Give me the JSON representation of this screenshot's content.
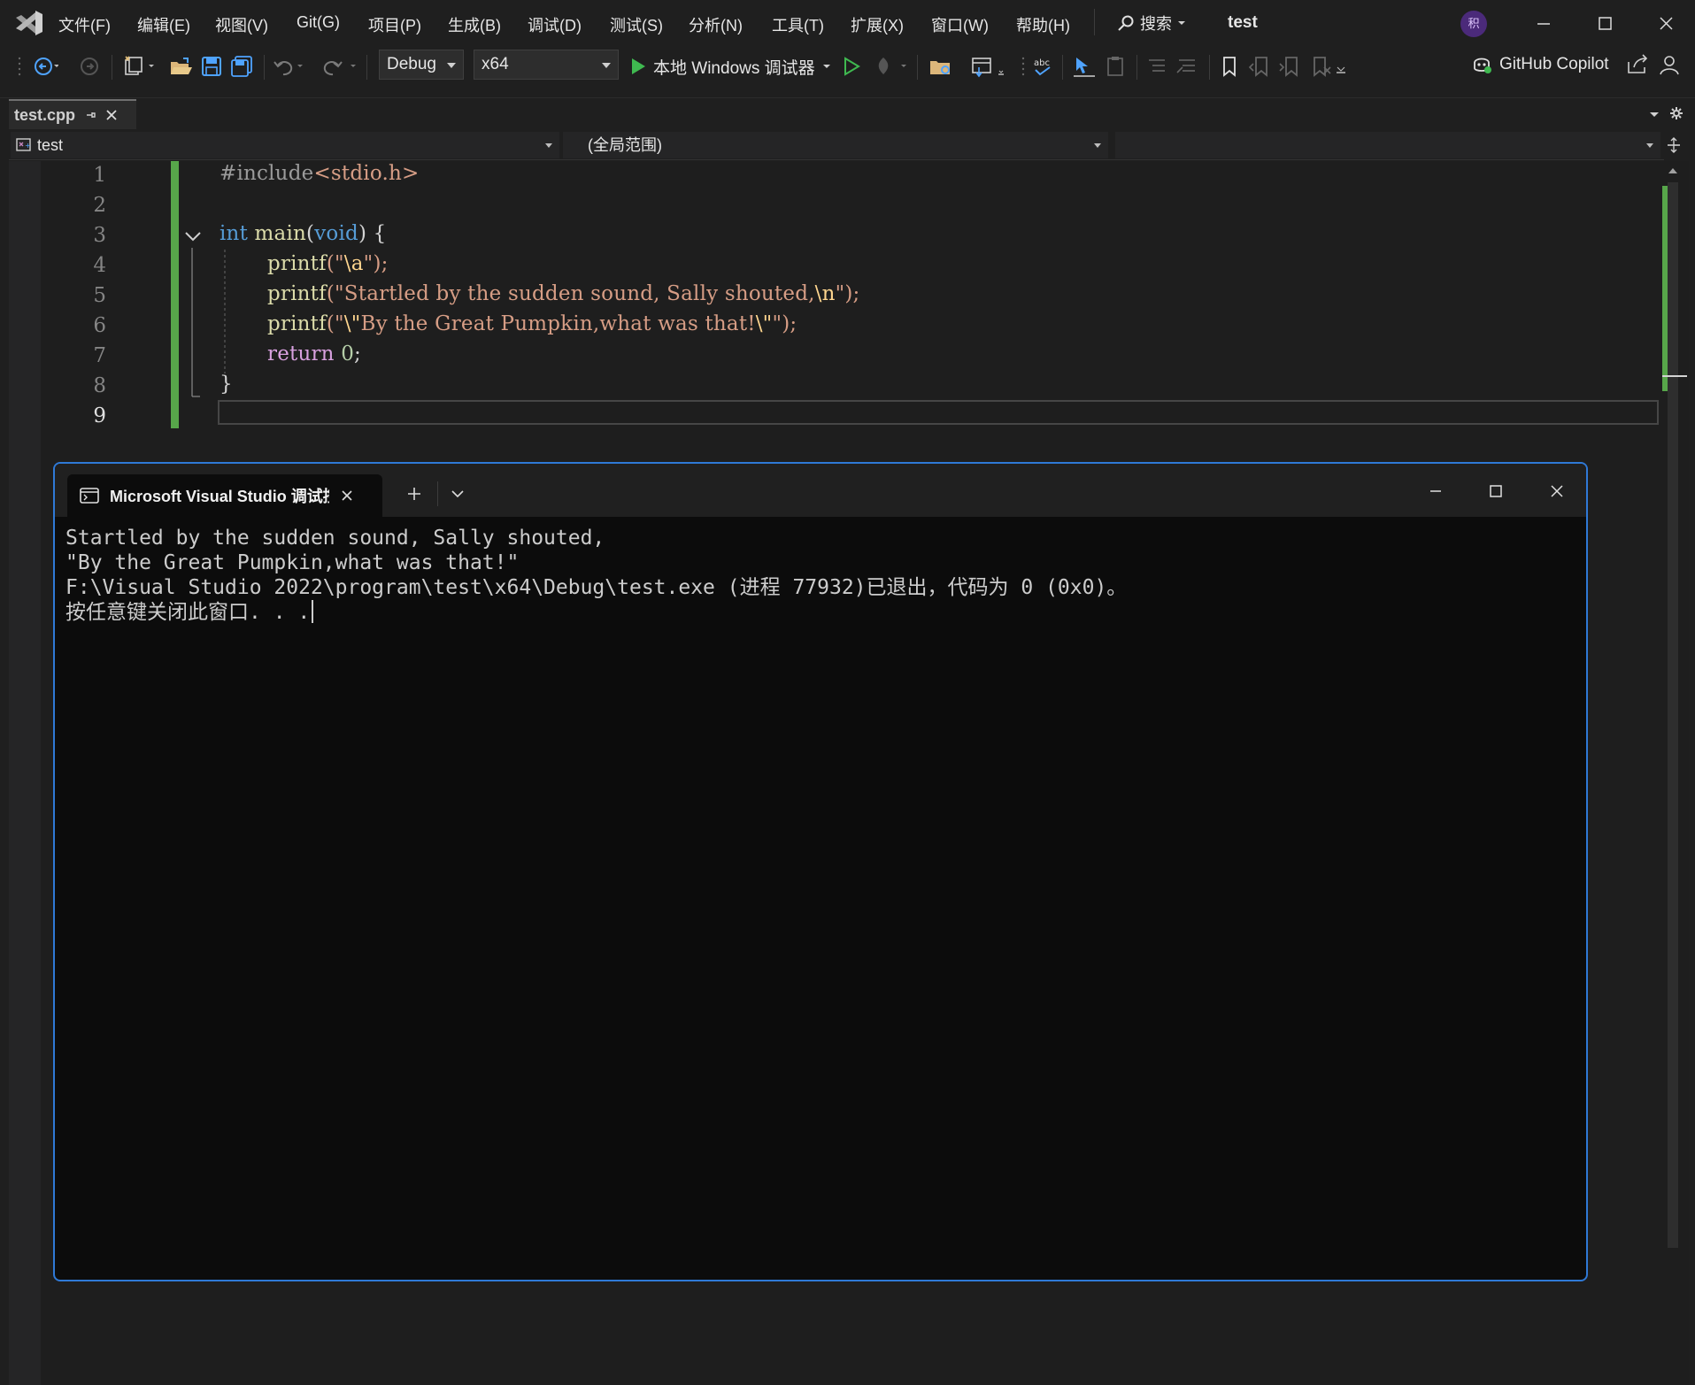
{
  "menubar": {
    "items": [
      "文件(F)",
      "编辑(E)",
      "视图(V)",
      "Git(G)",
      "项目(P)",
      "生成(B)",
      "调试(D)",
      "测试(S)",
      "分析(N)",
      "工具(T)",
      "扩展(X)",
      "窗口(W)",
      "帮助(H)"
    ],
    "search_label": "搜索",
    "solution_name": "test",
    "avatar_initial": "积"
  },
  "toolbar": {
    "configuration": "Debug",
    "platform": "x64",
    "run_label": "本地 Windows 调试器",
    "copilot_label": "GitHub Copilot"
  },
  "document_tab": {
    "label": "test.cpp"
  },
  "navbar": {
    "project": "test",
    "scope": "(全局范围)",
    "member": ""
  },
  "editor": {
    "line_numbers": [
      "1",
      "2",
      "3",
      "4",
      "5",
      "6",
      "7",
      "8",
      "9"
    ],
    "current_line": "9",
    "code": {
      "l1_include": "#include",
      "l1_header": "<stdio.h>",
      "l3_int": "int",
      "l3_main": "main",
      "l3_lparen": "(",
      "l3_void": "void",
      "l3_rest": ") {",
      "l4_printf": "printf",
      "l4_open": "(\"",
      "l4_esc": "\\a",
      "l4_close": "\");",
      "l5_printf": "printf",
      "l5_open": "(\"",
      "l5_text": "Startled by the sudden sound, Sally shouted,",
      "l5_esc": "\\n",
      "l5_close": "\");",
      "l6_printf": "printf",
      "l6_open": "(\"",
      "l6_esc1": "\\\"",
      "l6_text": "By the Great Pumpkin,what was that!",
      "l6_esc2": "\\\"",
      "l6_close": "\");",
      "l7_return": "return",
      "l7_zero": "0",
      "l7_semi": ";",
      "l8_brace": "}"
    }
  },
  "console": {
    "tab_title": "Microsoft Visual Studio 调试控制台",
    "lines": [
      "Startled by the sudden sound, Sally shouted,",
      "\"By the Great Pumpkin,what was that!\"",
      "F:\\Visual Studio 2022\\program\\test\\x64\\Debug\\test.exe (进程 77932)已退出，代码为 0 (0x0)。",
      "按任意键关闭此窗口. . ."
    ]
  },
  "colors": {
    "accent_border": "#2f79d6",
    "change_bar": "#57a64a",
    "keyword": "#569cd6",
    "string": "#d69d85",
    "function": "#dcdcaa"
  }
}
